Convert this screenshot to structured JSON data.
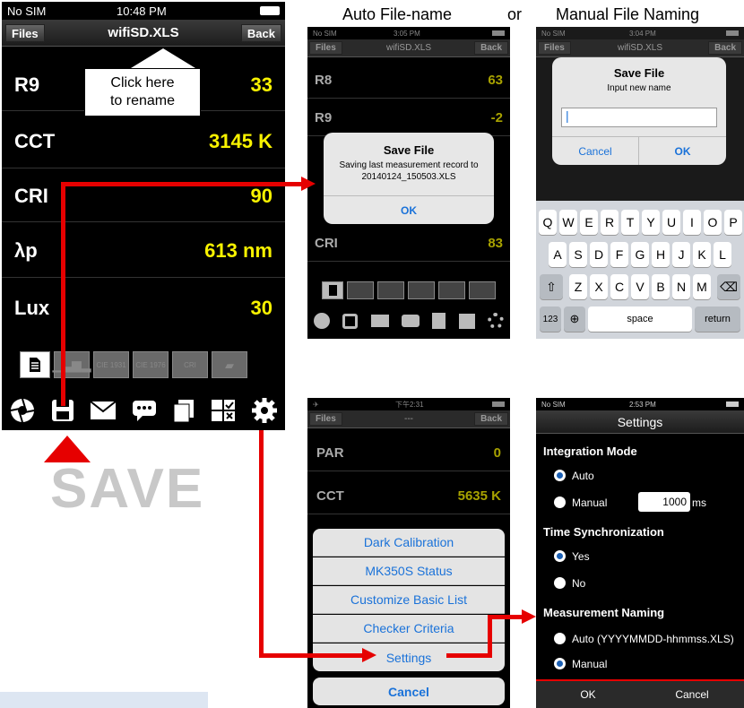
{
  "headings": {
    "auto": "Auto File-name",
    "or": "or",
    "manual": "Manual File Naming"
  },
  "main": {
    "status": {
      "carrier": "No SIM",
      "time": "10:48 PM"
    },
    "nav": {
      "left": "Files",
      "title": "wifiSD.XLS",
      "right": "Back"
    },
    "callout": "Click here\nto rename",
    "rows": [
      {
        "label": "R9",
        "value": "33"
      },
      {
        "label": "CCT",
        "value": "3145 K"
      },
      {
        "label": "CRI",
        "value": "90"
      },
      {
        "label": "λp",
        "value": "613 nm"
      },
      {
        "label": "Lux",
        "value": "30"
      }
    ],
    "tabs": [
      "",
      "",
      "CIE 1931",
      "CIE 1976",
      "CRI",
      ""
    ],
    "save_label": "SAVE"
  },
  "auto": {
    "status": {
      "carrier": "No SIM",
      "time": "3:05 PM"
    },
    "nav": {
      "left": "Files",
      "title": "wifiSD.XLS",
      "right": "Back"
    },
    "rows": [
      {
        "label": "R8",
        "value": "63"
      },
      {
        "label": "R9",
        "value": "-2"
      },
      {
        "label": "CRI",
        "value": "83"
      }
    ],
    "dialog": {
      "title": "Save File",
      "line1": "Saving last measurement record to",
      "line2": "20140124_150503.XLS",
      "ok": "OK"
    }
  },
  "manual": {
    "status": {
      "carrier": "No SIM",
      "time": "3:04 PM"
    },
    "nav": {
      "left": "Files",
      "title": "wifiSD.XLS",
      "right": "Back"
    },
    "dialog": {
      "title": "Save File",
      "message": "Input new name",
      "cancel": "Cancel",
      "ok": "OK"
    },
    "keyboard": {
      "row1": [
        "Q",
        "W",
        "E",
        "R",
        "T",
        "Y",
        "U",
        "I",
        "O",
        "P"
      ],
      "row2": [
        "A",
        "S",
        "D",
        "F",
        "G",
        "H",
        "J",
        "K",
        "L"
      ],
      "row3": [
        "Z",
        "X",
        "C",
        "V",
        "B",
        "N",
        "M"
      ],
      "num": "123",
      "space": "space",
      "return": "return"
    }
  },
  "menu": {
    "status": {
      "time": "下午2:31"
    },
    "nav": {
      "left": "Files",
      "title": "---",
      "right": "Back"
    },
    "rows": [
      {
        "label": "PAR",
        "value": "0"
      },
      {
        "label": "CCT",
        "value": "5635 K"
      }
    ],
    "actions": [
      "Dark Calibration",
      "MK350S Status",
      "Customize Basic List",
      "Checker Criteria",
      "Settings"
    ],
    "cancel": "Cancel"
  },
  "settings": {
    "status": {
      "carrier": "No SIM",
      "time": "2:53 PM"
    },
    "title": "Settings",
    "integration": {
      "head": "Integration Mode",
      "auto": "Auto",
      "manual": "Manual",
      "value": "1000",
      "unit": "ms"
    },
    "sync": {
      "head": "Time Synchronization",
      "yes": "Yes",
      "no": "No"
    },
    "naming": {
      "head": "Measurement Naming",
      "auto": "Auto (YYYYMMDD-hhmmss.XLS)",
      "manual": "Manual"
    },
    "ok": "OK",
    "cancel": "Cancel"
  }
}
